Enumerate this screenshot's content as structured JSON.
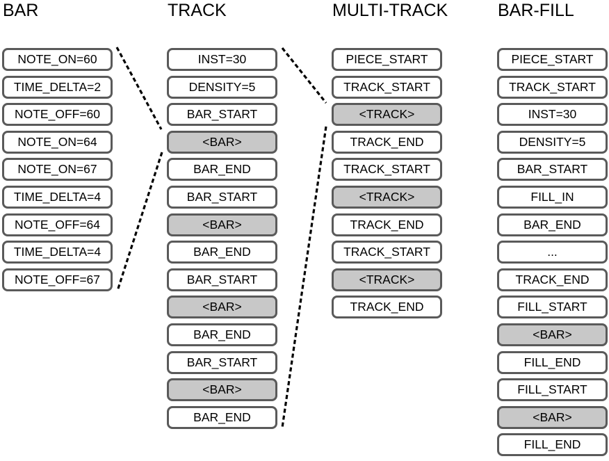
{
  "columns": [
    {
      "title": "BAR",
      "tokens": [
        {
          "label": "NOTE_ON=60",
          "placeholder": false
        },
        {
          "label": "TIME_DELTA=2",
          "placeholder": false
        },
        {
          "label": "NOTE_OFF=60",
          "placeholder": false
        },
        {
          "label": "NOTE_ON=64",
          "placeholder": false
        },
        {
          "label": "NOTE_ON=67",
          "placeholder": false
        },
        {
          "label": "TIME_DELTA=4",
          "placeholder": false
        },
        {
          "label": "NOTE_OFF=64",
          "placeholder": false
        },
        {
          "label": "TIME_DELTA=4",
          "placeholder": false
        },
        {
          "label": "NOTE_OFF=67",
          "placeholder": false
        }
      ]
    },
    {
      "title": "TRACK",
      "tokens": [
        {
          "label": "INST=30",
          "placeholder": false
        },
        {
          "label": "DENSITY=5",
          "placeholder": false
        },
        {
          "label": "BAR_START",
          "placeholder": false
        },
        {
          "label": "<BAR>",
          "placeholder": true
        },
        {
          "label": "BAR_END",
          "placeholder": false
        },
        {
          "label": "BAR_START",
          "placeholder": false
        },
        {
          "label": "<BAR>",
          "placeholder": true
        },
        {
          "label": "BAR_END",
          "placeholder": false
        },
        {
          "label": "BAR_START",
          "placeholder": false
        },
        {
          "label": "<BAR>",
          "placeholder": true
        },
        {
          "label": "BAR_END",
          "placeholder": false
        },
        {
          "label": "BAR_START",
          "placeholder": false
        },
        {
          "label": "<BAR>",
          "placeholder": true
        },
        {
          "label": "BAR_END",
          "placeholder": false
        }
      ]
    },
    {
      "title": "MULTI-TRACK",
      "tokens": [
        {
          "label": "PIECE_START",
          "placeholder": false
        },
        {
          "label": "TRACK_START",
          "placeholder": false
        },
        {
          "label": "<TRACK>",
          "placeholder": true
        },
        {
          "label": "TRACK_END",
          "placeholder": false
        },
        {
          "label": "TRACK_START",
          "placeholder": false
        },
        {
          "label": "<TRACK>",
          "placeholder": true
        },
        {
          "label": "TRACK_END",
          "placeholder": false
        },
        {
          "label": "TRACK_START",
          "placeholder": false
        },
        {
          "label": "<TRACK>",
          "placeholder": true
        },
        {
          "label": "TRACK_END",
          "placeholder": false
        }
      ]
    },
    {
      "title": "BAR-FILL",
      "tokens": [
        {
          "label": "PIECE_START",
          "placeholder": false
        },
        {
          "label": "TRACK_START",
          "placeholder": false
        },
        {
          "label": "INST=30",
          "placeholder": false
        },
        {
          "label": "DENSITY=5",
          "placeholder": false
        },
        {
          "label": "BAR_START",
          "placeholder": false
        },
        {
          "label": "FILL_IN",
          "placeholder": false
        },
        {
          "label": "BAR_END",
          "placeholder": false
        },
        {
          "label": "...",
          "placeholder": false
        },
        {
          "label": "TRACK_END",
          "placeholder": false
        },
        {
          "label": "FILL_START",
          "placeholder": false
        },
        {
          "label": "<BAR>",
          "placeholder": true
        },
        {
          "label": "FILL_END",
          "placeholder": false
        },
        {
          "label": "FILL_START",
          "placeholder": false
        },
        {
          "label": "<BAR>",
          "placeholder": true
        },
        {
          "label": "FILL_END",
          "placeholder": false
        }
      ]
    }
  ],
  "connectors": [
    {
      "from_column": "BAR",
      "to_column": "TRACK",
      "expands_token": "<BAR>",
      "to_row": 3
    },
    {
      "from_column": "TRACK",
      "to_column": "MULTI-TRACK",
      "expands_token": "<TRACK>",
      "to_row": 2
    }
  ],
  "colors": {
    "placeholder_fill": "#c8c8c8",
    "token_border": "#5a5a5a",
    "connector": "#000000"
  }
}
